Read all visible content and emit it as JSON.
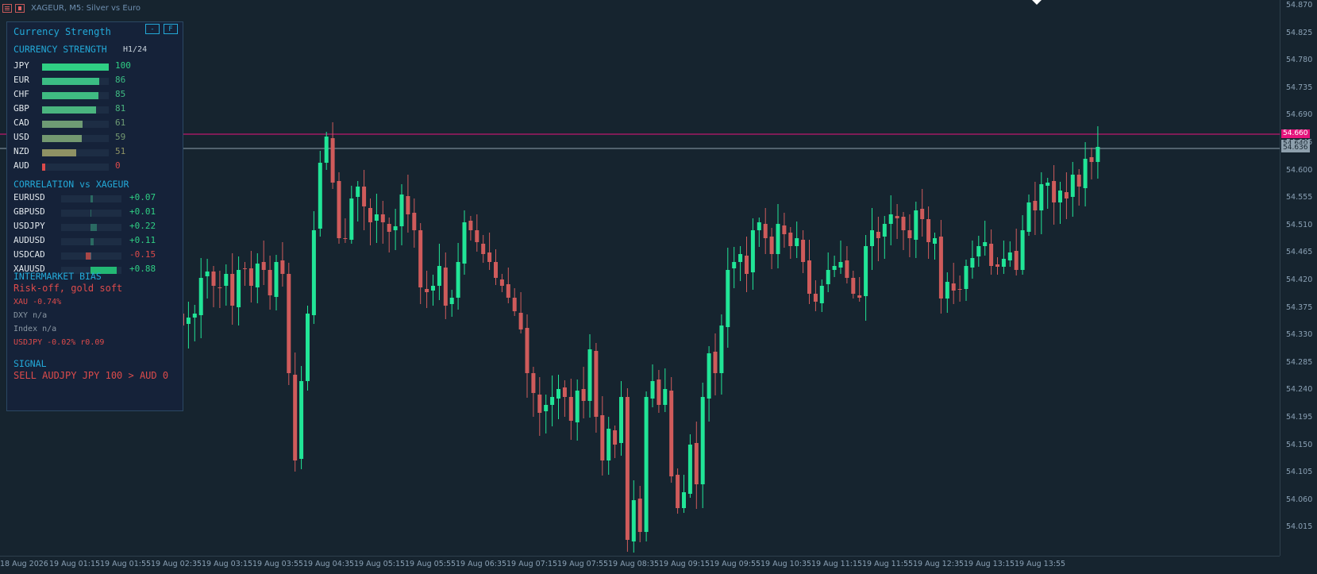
{
  "header": {
    "symbol_title": "XAGEUR, M5:  Silver vs Euro"
  },
  "price_axis": {
    "ticks": [
      "54.870",
      "54.825",
      "54.780",
      "54.735",
      "54.690",
      "54.645",
      "54.600",
      "54.555",
      "54.510",
      "54.465",
      "54.420",
      "54.375",
      "54.330",
      "54.285",
      "54.240",
      "54.195",
      "54.150",
      "54.105",
      "54.060",
      "54.015"
    ],
    "tag_pink": "54.660",
    "tag_grey": "54.636",
    "tag_grey_behind": "54.640"
  },
  "time_axis": {
    "labels": [
      "18 Aug 2026",
      "19 Aug 01:15",
      "19 Aug 01:55",
      "19 Aug 02:35",
      "19 Aug 03:15",
      "19 Aug 03:55",
      "19 Aug 04:35",
      "19 Aug 05:15",
      "19 Aug 05:55",
      "19 Aug 06:35",
      "19 Aug 07:15",
      "19 Aug 07:55",
      "19 Aug 08:35",
      "19 Aug 09:15",
      "19 Aug 09:55",
      "19 Aug 10:35",
      "19 Aug 11:15",
      "19 Aug 11:55",
      "19 Aug 12:35",
      "19 Aug 13:15",
      "19 Aug 13:55"
    ]
  },
  "colors": {
    "bull": "#21e597",
    "bear": "#cf5b5b",
    "pink_line": "#e5147c",
    "grey_line": "#8ea0ad",
    "accent": "#23a9d8",
    "negative": "#dc4b4b",
    "positive": "#2fcf84"
  },
  "panel": {
    "title": "Currency Strength",
    "btn_minimize": "-",
    "btn_full": "F",
    "strength_title": "CURRENCY STRENGTH",
    "timeframe": "H1/24",
    "strength": [
      {
        "name": "JPY",
        "value": 100,
        "label": "100",
        "color": "#2fcf84"
      },
      {
        "name": "EUR",
        "value": 86,
        "label": "86",
        "color": "#3bbd84"
      },
      {
        "name": "CHF",
        "value": 85,
        "label": "85",
        "color": "#3fbb82"
      },
      {
        "name": "GBP",
        "value": 81,
        "label": "81",
        "color": "#4ab57f"
      },
      {
        "name": "CAD",
        "value": 61,
        "label": "61",
        "color": "#6e9b74"
      },
      {
        "name": "USD",
        "value": 59,
        "label": "59",
        "color": "#739870"
      },
      {
        "name": "NZD",
        "value": 51,
        "label": "51",
        "color": "#8f9264"
      },
      {
        "name": "AUD",
        "value": 0,
        "label": "0",
        "color": "#dc4b4b"
      }
    ],
    "corr_title": "CORRELATION vs XAGEUR",
    "correlation": [
      {
        "name": "EURUSD",
        "value": 0.07,
        "label": "+0.07"
      },
      {
        "name": "GBPUSD",
        "value": 0.01,
        "label": "+0.01"
      },
      {
        "name": "USDJPY",
        "value": 0.22,
        "label": "+0.22"
      },
      {
        "name": "AUDUSD",
        "value": 0.11,
        "label": "+0.11"
      },
      {
        "name": "USDCAD",
        "value": -0.15,
        "label": "-0.15"
      },
      {
        "name": "XAUUSD",
        "value": 0.88,
        "label": "+0.88"
      }
    ],
    "bias_title": "INTERMARKET BIAS",
    "bias_main": "Risk-off, gold soft",
    "bias_lines": [
      {
        "text": "XAU -0.74%",
        "color": "#dc4b4b"
      },
      {
        "text": "DXY n/a",
        "color": "#8b98a4"
      },
      {
        "text": "Index n/a",
        "color": "#8b98a4"
      },
      {
        "text": "USDJPY -0.02%  r0.09",
        "color": "#dc4b4b"
      }
    ],
    "signal_title": "SIGNAL",
    "signal_text": "SELL AUDJPY  JPY 100 > AUD 0"
  }
}
